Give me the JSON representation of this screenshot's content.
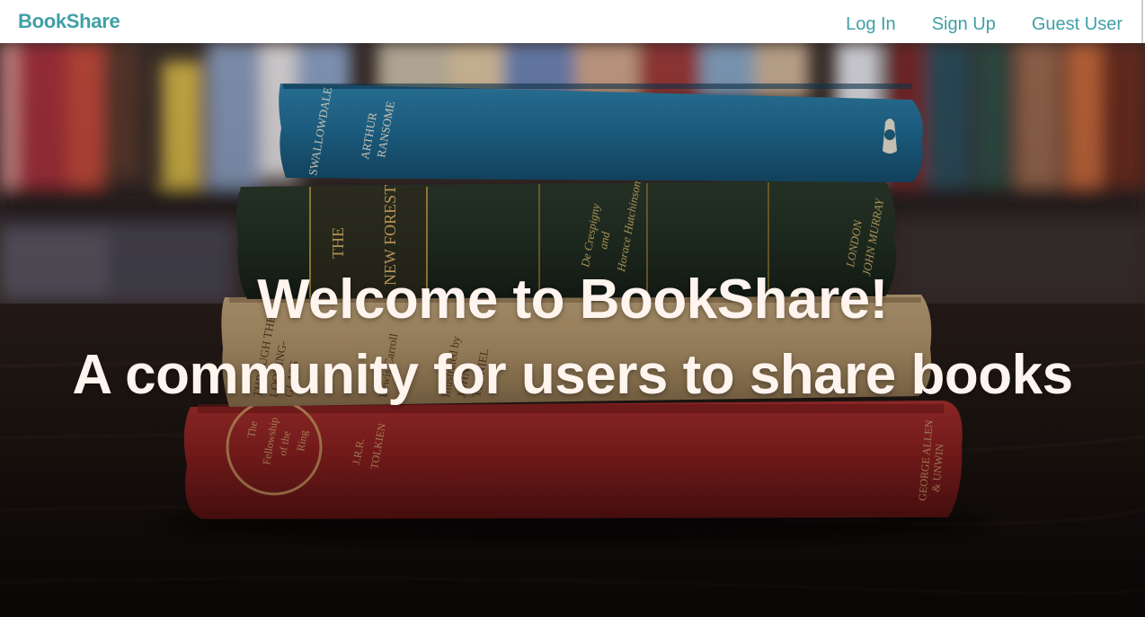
{
  "navbar": {
    "brand": "BookShare",
    "links": [
      {
        "label": "Log In"
      },
      {
        "label": "Sign Up"
      },
      {
        "label": "Guest User"
      }
    ]
  },
  "hero": {
    "title": "Welcome to BookShare!",
    "subtitle": "A community for users to share books",
    "background_image": "stack of old hardcover books on a wooden table with bookshelf behind"
  },
  "colors": {
    "accent": "#3fa0a6",
    "hero_text": "#fff4ee"
  }
}
